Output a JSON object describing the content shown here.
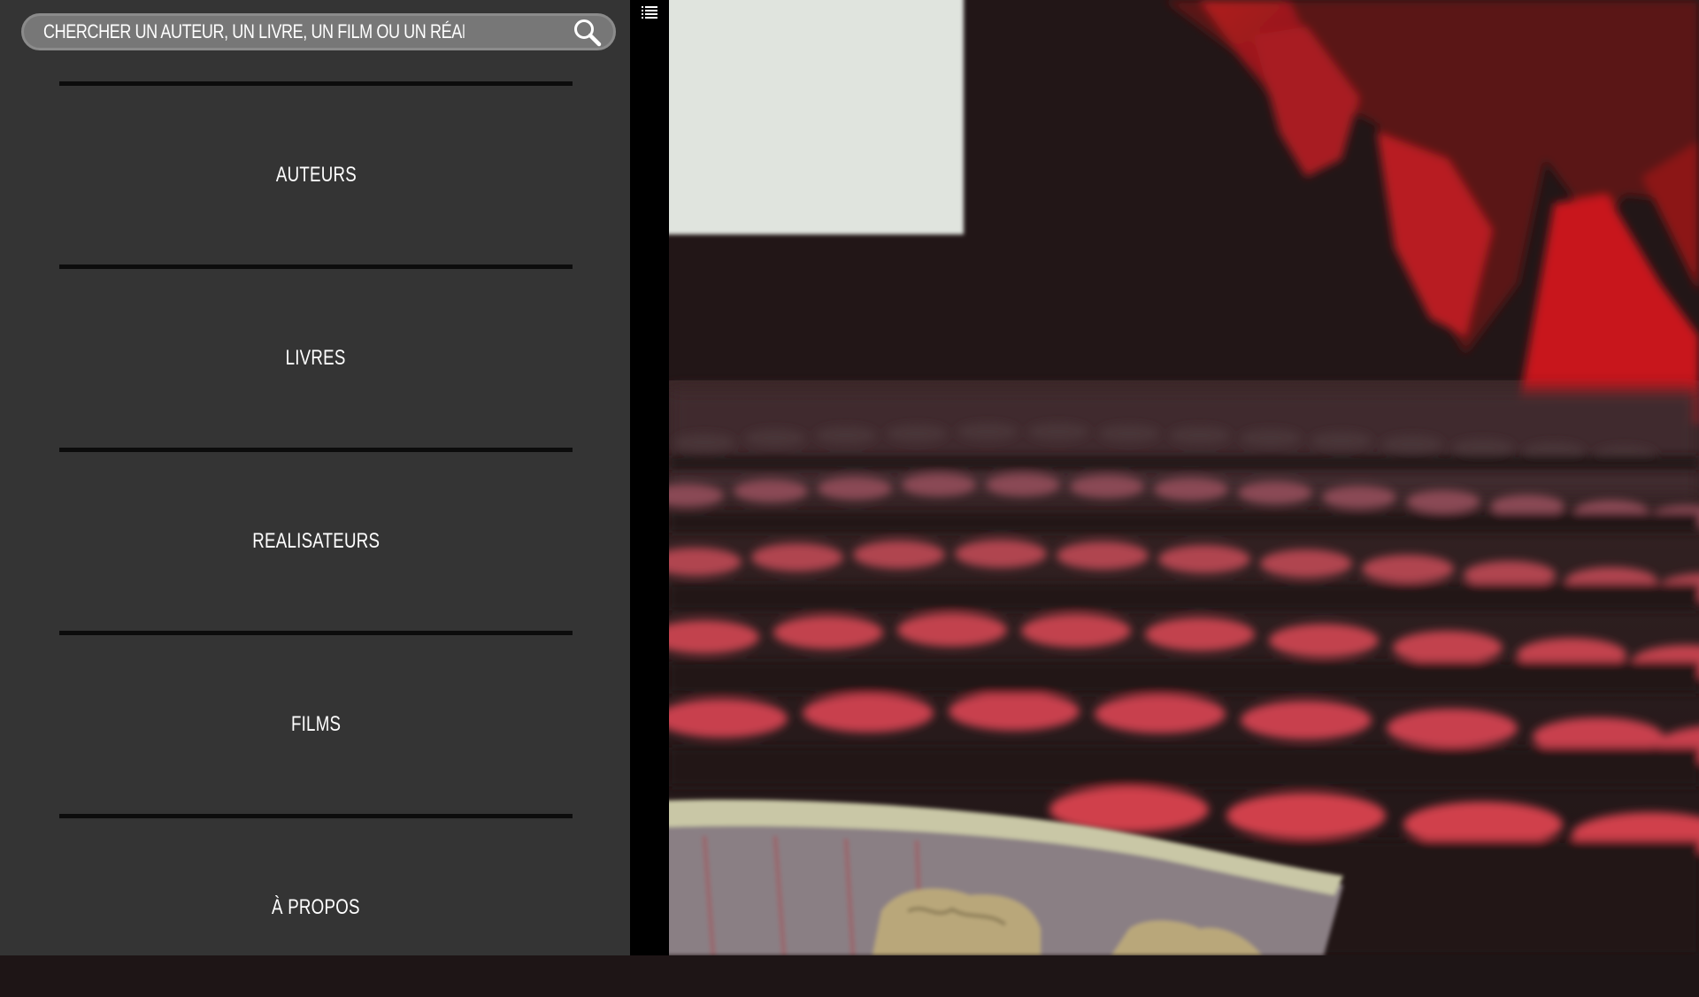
{
  "search": {
    "placeholder": "CHERCHER UN AUTEUR, UN LIVRE, UN FILM OU UN RÉALISATEUR",
    "value": "",
    "button_icon": "magnifier-icon"
  },
  "nav": {
    "items": [
      {
        "label": "AUTEURS"
      },
      {
        "label": "LIVRES"
      },
      {
        "label": "REALISATEURS"
      },
      {
        "label": "FILMS"
      },
      {
        "label": "À PROPOS"
      }
    ]
  },
  "menu_toggle": {
    "icon": "list-icon"
  },
  "hero": {
    "image": "blurred cinema theater background"
  },
  "colors": {
    "sidebar_bg": "#343434",
    "search_bg": "#777777",
    "divider": "#0c0c0c",
    "strip": "#000000",
    "text": "#ffffff",
    "seat_red": "#c62a32"
  }
}
